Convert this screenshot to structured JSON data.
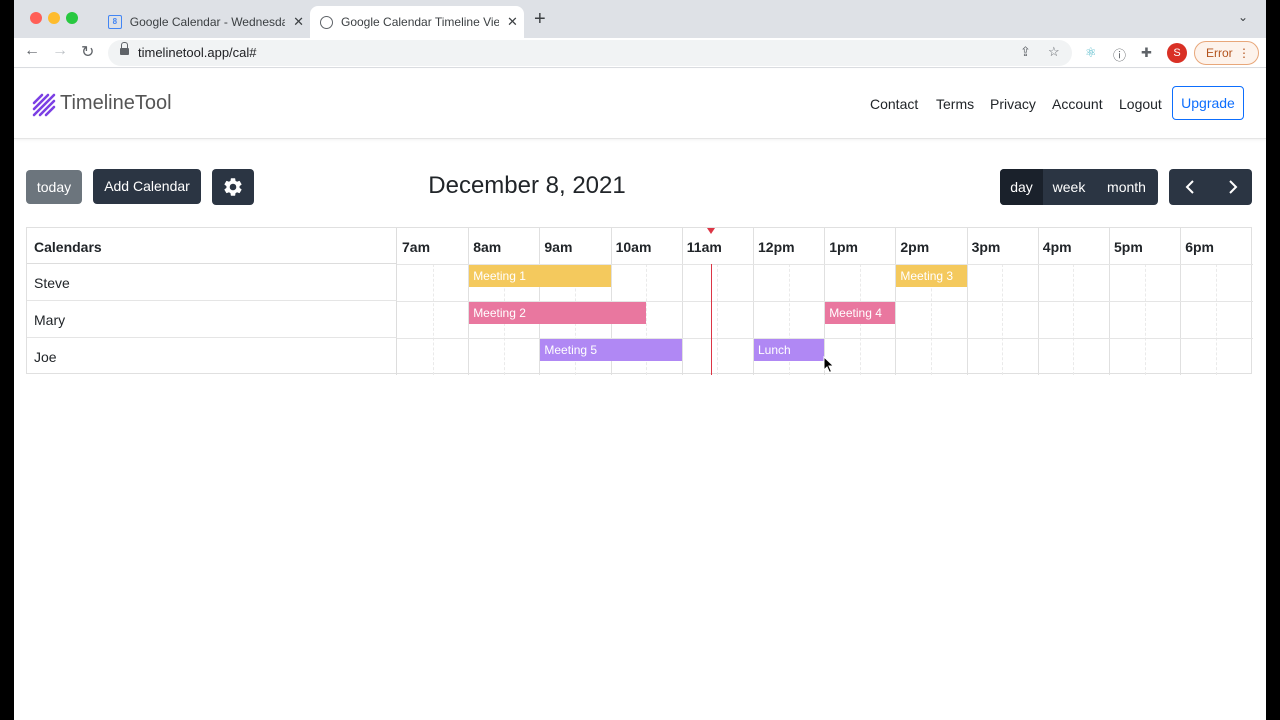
{
  "browser": {
    "tabs": [
      {
        "title": "Google Calendar - Wednesday,",
        "close": "✕"
      },
      {
        "title": "Google Calendar Timeline View",
        "close": "✕"
      }
    ],
    "new_tab": "+",
    "url": "timelinetool.app/cal#",
    "profile_initial": "S",
    "error_label": "Error"
  },
  "site": {
    "brand": "TimelineTool",
    "nav": [
      "Contact",
      "Terms",
      "Privacy",
      "Account",
      "Logout"
    ],
    "upgrade_label": "Upgrade"
  },
  "controls": {
    "today_label": "today",
    "add_calendar_label": "Add Calendar",
    "date": "December 8, 2021",
    "views": [
      "day",
      "week",
      "month"
    ],
    "active_view": "day"
  },
  "timeline": {
    "calendars_header": "Calendars",
    "hours": [
      "7am",
      "8am",
      "9am",
      "10am",
      "11am",
      "12pm",
      "1pm",
      "2pm",
      "3pm",
      "4pm",
      "5pm",
      "6pm"
    ],
    "rows": [
      {
        "name": "Steve",
        "events": [
          {
            "title": "Meeting 1",
            "start": "8:00",
            "end": "10:00",
            "color": "#f4c95d"
          },
          {
            "title": "Meeting 3",
            "start": "14:00",
            "end": "15:00",
            "color": "#f4c95d"
          }
        ]
      },
      {
        "name": "Mary",
        "events": [
          {
            "title": "Meeting 2",
            "start": "8:00",
            "end": "10:30",
            "color": "#e9779f"
          },
          {
            "title": "Meeting 4",
            "start": "13:00",
            "end": "14:00",
            "color": "#e9779f"
          }
        ]
      },
      {
        "name": "Joe",
        "events": [
          {
            "title": "Meeting 5",
            "start": "9:00",
            "end": "11:00",
            "color": "#b088f4"
          },
          {
            "title": "Lunch",
            "start": "12:00",
            "end": "13:00",
            "color": "#b088f4"
          }
        ]
      }
    ],
    "current_time": "11:25"
  }
}
